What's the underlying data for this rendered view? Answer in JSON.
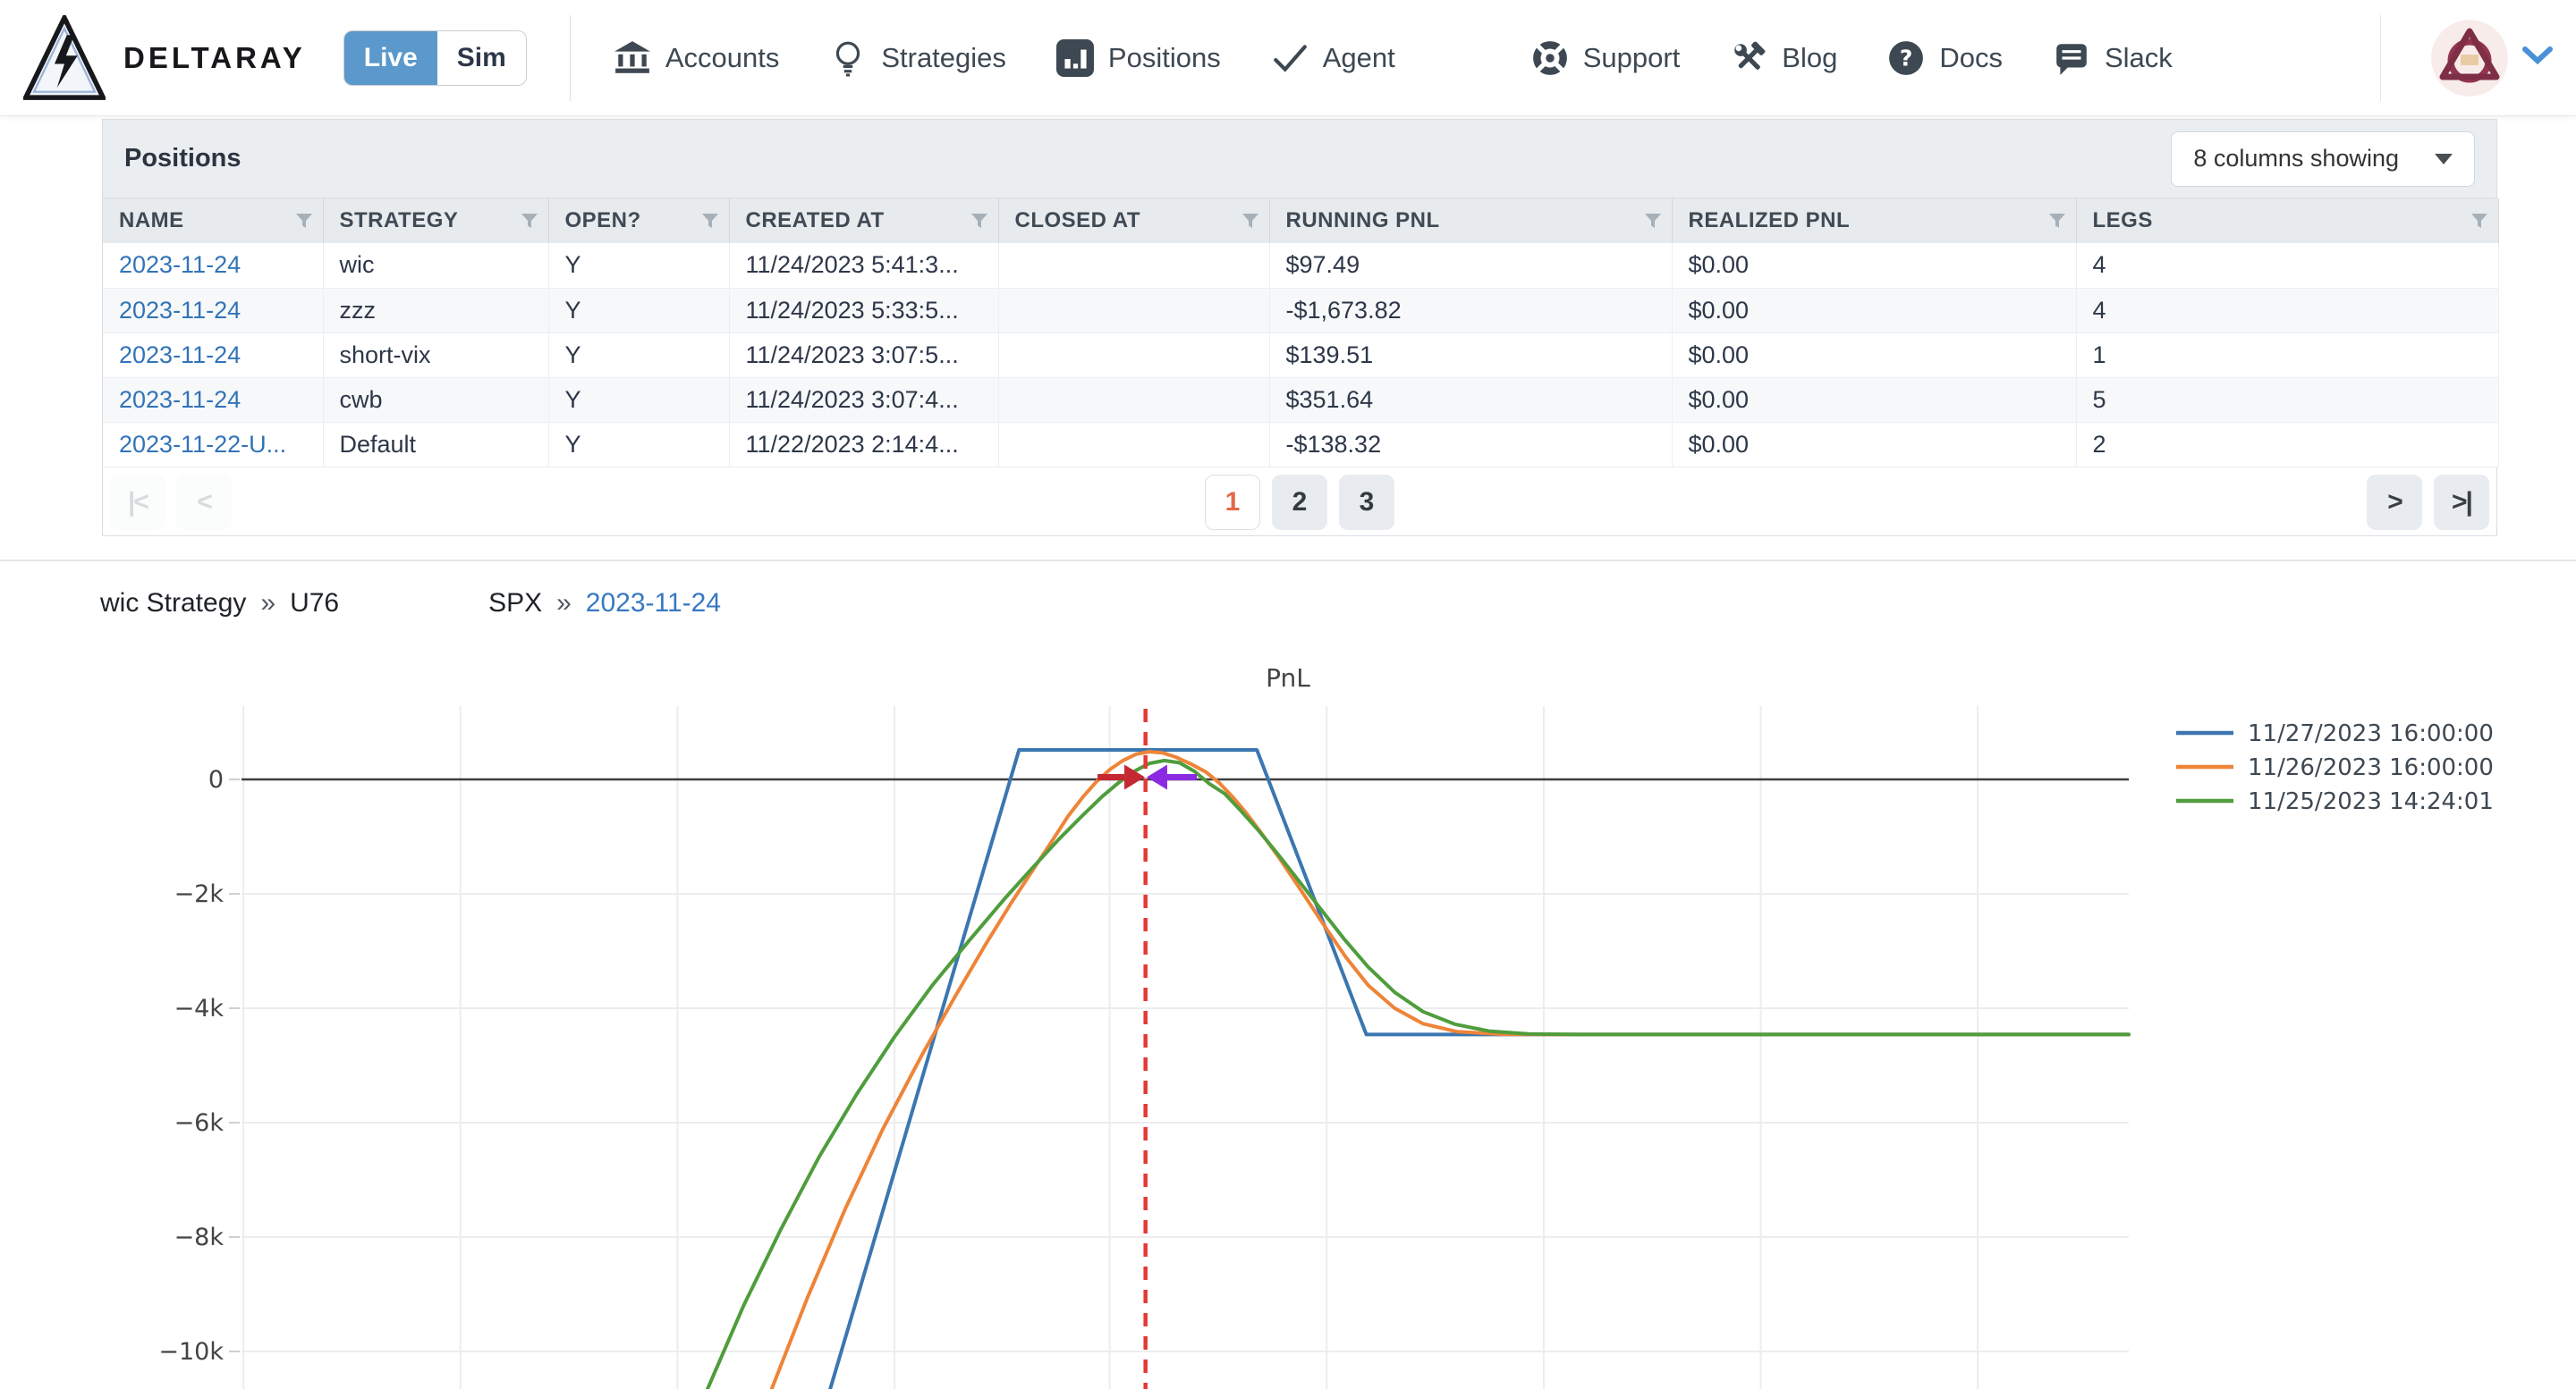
{
  "nav": {
    "brand": "DELTARAY",
    "mode_toggle": {
      "live": "Live",
      "sim": "Sim"
    },
    "items": [
      {
        "label": "Accounts",
        "icon": "bank-icon"
      },
      {
        "label": "Strategies",
        "icon": "lightbulb-icon"
      },
      {
        "label": "Positions",
        "icon": "bar-chart-icon"
      },
      {
        "label": "Agent",
        "icon": "check-icon"
      },
      {
        "label": "Support",
        "icon": "life-ring-icon"
      },
      {
        "label": "Blog",
        "icon": "tools-icon"
      },
      {
        "label": "Docs",
        "icon": "question-circle-icon"
      },
      {
        "label": "Slack",
        "icon": "chat-icon"
      }
    ]
  },
  "positions_panel": {
    "title": "Positions",
    "columns_dropdown": "8 columns showing",
    "columns": [
      "NAME",
      "STRATEGY",
      "OPEN?",
      "CREATED AT",
      "CLOSED AT",
      "RUNNING PNL",
      "REALIZED PNL",
      "LEGS"
    ],
    "rows": [
      {
        "name": "2023-11-24",
        "strategy": "wic",
        "open": "Y",
        "created_at": "11/24/2023 5:41:3...",
        "closed_at": "",
        "running_pnl": "$97.49",
        "realized_pnl": "$0.00",
        "legs": "4"
      },
      {
        "name": "2023-11-24",
        "strategy": "zzz",
        "open": "Y",
        "created_at": "11/24/2023 5:33:5...",
        "closed_at": "",
        "running_pnl": "-$1,673.82",
        "realized_pnl": "$0.00",
        "legs": "4"
      },
      {
        "name": "2023-11-24",
        "strategy": "short-vix",
        "open": "Y",
        "created_at": "11/24/2023 3:07:5...",
        "closed_at": "",
        "running_pnl": "$139.51",
        "realized_pnl": "$0.00",
        "legs": "1"
      },
      {
        "name": "2023-11-24",
        "strategy": "cwb",
        "open": "Y",
        "created_at": "11/24/2023 3:07:4...",
        "closed_at": "",
        "running_pnl": "$351.64",
        "realized_pnl": "$0.00",
        "legs": "5"
      },
      {
        "name": "2023-11-22-U...",
        "strategy": "Default",
        "open": "Y",
        "created_at": "11/22/2023 2:14:4...",
        "closed_at": "",
        "running_pnl": "-$138.32",
        "realized_pnl": "$0.00",
        "legs": "2"
      }
    ],
    "pagination": {
      "first_label": "|<",
      "prev_label": "<",
      "next_label": ">",
      "last_label": ">|",
      "pages": [
        "1",
        "2",
        "3"
      ],
      "active_page": "1"
    }
  },
  "breadcrumb": {
    "strategy": "wic Strategy",
    "sep1": "»",
    "account": "U76",
    "symbol": "SPX",
    "sep2": "»",
    "date": "2023-11-24"
  },
  "chart_data": {
    "type": "line",
    "title": "PnL",
    "xlabel": "",
    "ylabel": "",
    "x_unit": "fraction-of-plot-width (x-axis labels cut off below screenshot)",
    "ylim_visible": [
      -10650,
      1290
    ],
    "yticks": [
      {
        "value": 0,
        "label": "0"
      },
      {
        "value": -2000,
        "label": "−2k"
      },
      {
        "value": -4000,
        "label": "−4k"
      },
      {
        "value": -6000,
        "label": "−6k"
      },
      {
        "value": -8000,
        "label": "−8k"
      },
      {
        "value": -10000,
        "label": "−10k"
      }
    ],
    "x_gridlines_frac": [
      0.001,
      0.116,
      0.231,
      0.346,
      0.46,
      0.575,
      0.69,
      0.805,
      0.92
    ],
    "grid_color": "#ebedee",
    "zero_line_color": "#3d3d3d",
    "legend_position": "top-right",
    "series": [
      {
        "name": "11/27/2023 16:00:00",
        "color": "#3b76b0",
        "points": [
          [
            0.312,
            -10650
          ],
          [
            0.412,
            515
          ],
          [
            0.538,
            515
          ],
          [
            0.596,
            -4460
          ],
          [
            1.0,
            -4460
          ]
        ]
      },
      {
        "name": "11/26/2023 16:00:00",
        "color": "#ee8438",
        "points": [
          [
            0.281,
            -10650
          ],
          [
            0.3,
            -9050
          ],
          [
            0.32,
            -7500
          ],
          [
            0.34,
            -6100
          ],
          [
            0.36,
            -4850
          ],
          [
            0.378,
            -3800
          ],
          [
            0.394,
            -2900
          ],
          [
            0.408,
            -2150
          ],
          [
            0.42,
            -1550
          ],
          [
            0.43,
            -1050
          ],
          [
            0.438,
            -640
          ],
          [
            0.446,
            -300
          ],
          [
            0.453,
            -40
          ],
          [
            0.46,
            170
          ],
          [
            0.467,
            330
          ],
          [
            0.474,
            440
          ],
          [
            0.481,
            485
          ],
          [
            0.488,
            465
          ],
          [
            0.495,
            390
          ],
          [
            0.503,
            270
          ],
          [
            0.511,
            130
          ],
          [
            0.518,
            -60
          ],
          [
            0.525,
            -300
          ],
          [
            0.532,
            -570
          ],
          [
            0.54,
            -920
          ],
          [
            0.55,
            -1380
          ],
          [
            0.561,
            -1920
          ],
          [
            0.573,
            -2520
          ],
          [
            0.585,
            -3100
          ],
          [
            0.597,
            -3600
          ],
          [
            0.611,
            -4000
          ],
          [
            0.626,
            -4270
          ],
          [
            0.644,
            -4410
          ],
          [
            0.668,
            -4455
          ],
          [
            0.7,
            -4460
          ],
          [
            1.0,
            -4460
          ]
        ]
      },
      {
        "name": "11/25/2023 14:24:01",
        "color": "#4f9d3c",
        "points": [
          [
            0.247,
            -10650
          ],
          [
            0.266,
            -9200
          ],
          [
            0.286,
            -7850
          ],
          [
            0.306,
            -6600
          ],
          [
            0.326,
            -5500
          ],
          [
            0.346,
            -4500
          ],
          [
            0.366,
            -3600
          ],
          [
            0.386,
            -2800
          ],
          [
            0.404,
            -2100
          ],
          [
            0.419,
            -1550
          ],
          [
            0.433,
            -1050
          ],
          [
            0.445,
            -650
          ],
          [
            0.456,
            -300
          ],
          [
            0.465,
            -50
          ],
          [
            0.473,
            140
          ],
          [
            0.481,
            280
          ],
          [
            0.489,
            330
          ],
          [
            0.497,
            290
          ],
          [
            0.505,
            140
          ],
          [
            0.513,
            -80
          ],
          [
            0.521,
            -250
          ],
          [
            0.529,
            -530
          ],
          [
            0.538,
            -860
          ],
          [
            0.548,
            -1260
          ],
          [
            0.559,
            -1720
          ],
          [
            0.571,
            -2230
          ],
          [
            0.584,
            -2780
          ],
          [
            0.597,
            -3280
          ],
          [
            0.611,
            -3720
          ],
          [
            0.626,
            -4060
          ],
          [
            0.643,
            -4280
          ],
          [
            0.661,
            -4400
          ],
          [
            0.682,
            -4450
          ],
          [
            0.71,
            -4460
          ],
          [
            1.0,
            -4460
          ]
        ]
      }
    ],
    "annotations": {
      "vline": {
        "x_frac": 0.479,
        "color": "#e53935",
        "style": "dashed"
      },
      "arrows": [
        {
          "direction": "right",
          "color": "#c62832",
          "x_from_frac": 0.4536,
          "x_to_frac": 0.4787,
          "value": 40
        },
        {
          "direction": "left",
          "color": "#8a2be2",
          "x_from_frac": 0.5062,
          "x_to_frac": 0.4796,
          "value": 40
        }
      ]
    }
  }
}
